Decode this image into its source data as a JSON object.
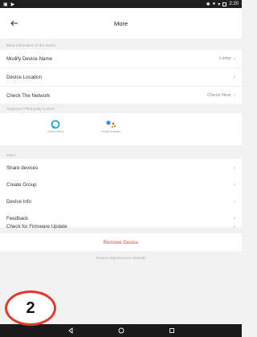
{
  "status_bar": {
    "time": "2:20"
  },
  "header": {
    "title": "More"
  },
  "sections": {
    "basic_label": "Basic information of the device",
    "third_party_label": "Supported Third-party Control",
    "other_label": "Other"
  },
  "basic_rows": [
    {
      "label": "Modify Device Name",
      "value": "Lamp"
    },
    {
      "label": "Device Location",
      "value": ""
    },
    {
      "label": "Check The Network",
      "value": "Check Now"
    }
  ],
  "third_party": [
    {
      "label": "Amazon Alexa",
      "icon": "alexa-icon"
    },
    {
      "label": "Google Assistant",
      "icon": "google-assistant-icon"
    }
  ],
  "other_rows": [
    {
      "label": "Share devices"
    },
    {
      "label": "Create Group"
    },
    {
      "label": "Device Info"
    },
    {
      "label": "Feedback"
    },
    {
      "label": "Check for Firmware Update"
    }
  ],
  "actions": {
    "remove": "Remove Device",
    "restore": "Restore Manufacturer Defaults"
  },
  "badge": {
    "number": "2"
  },
  "colors": {
    "remove": "#e64a3b",
    "badge_ring": "#e23a2e"
  }
}
